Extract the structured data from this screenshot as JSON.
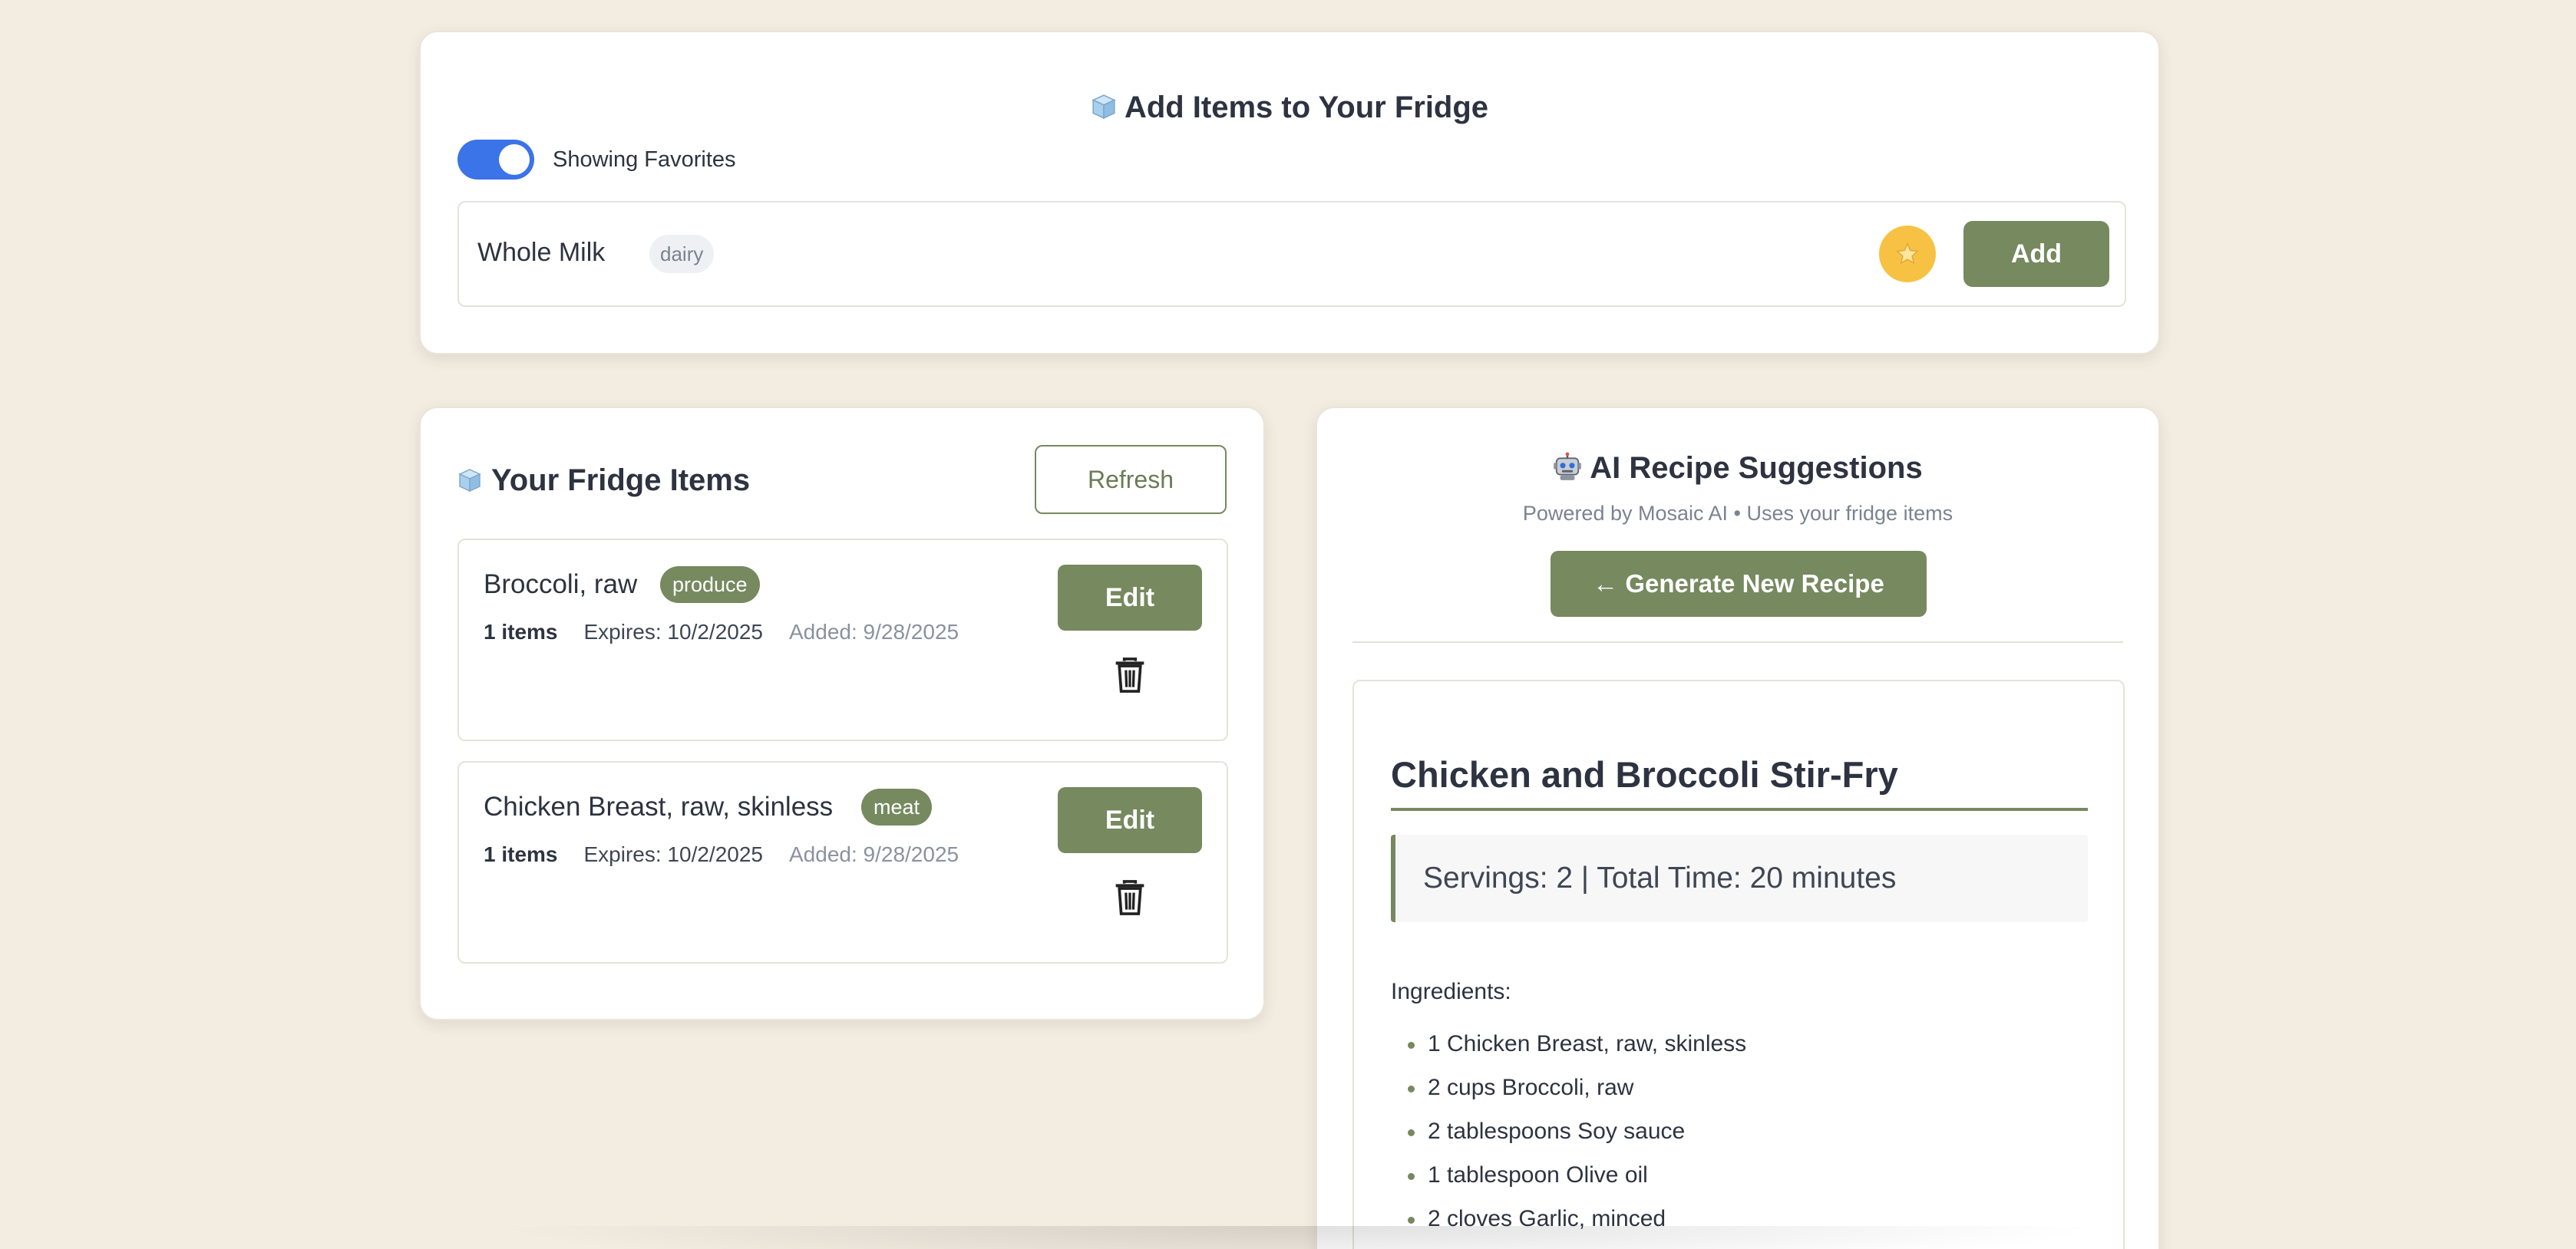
{
  "add_section": {
    "title": "Add Items to Your Fridge",
    "toggle_label": "Showing Favorites",
    "favorite": {
      "name": "Whole Milk",
      "category": "dairy"
    },
    "add_label": "Add"
  },
  "fridge_section": {
    "title": "Your Fridge Items",
    "refresh_label": "Refresh",
    "items": [
      {
        "name": "Broccoli, raw",
        "category": "produce",
        "quantity": "1 items",
        "expires": "Expires: 10/2/2025",
        "added": "Added: 9/28/2025",
        "edit_label": "Edit"
      },
      {
        "name": "Chicken Breast, raw, skinless",
        "category": "meat",
        "quantity": "1 items",
        "expires": "Expires: 10/2/2025",
        "added": "Added: 9/28/2025",
        "edit_label": "Edit"
      }
    ]
  },
  "recipe_section": {
    "title": "AI Recipe Suggestions",
    "subtitle": "Powered by Mosaic AI • Uses your fridge items",
    "generate_label": "← Generate New Recipe",
    "recipe": {
      "name": "Chicken and Broccoli Stir-Fry",
      "servings_line": "Servings: 2 | Total Time: 20 minutes",
      "ingredients_label": "Ingredients:",
      "ingredients": [
        "1 Chicken Breast, raw, skinless",
        "2 cups Broccoli, raw",
        "2 tablespoons Soy sauce",
        "1 tablespoon Olive oil",
        "2 cloves Garlic, minced"
      ]
    }
  },
  "colors": {
    "background": "#f3ece1",
    "accent_green": "#76895f",
    "toggle_blue": "#3b73e8",
    "star_yellow": "#f7c243"
  },
  "icons": [
    "ice-cube-icon",
    "robot-icon",
    "star-icon",
    "trash-icon"
  ]
}
